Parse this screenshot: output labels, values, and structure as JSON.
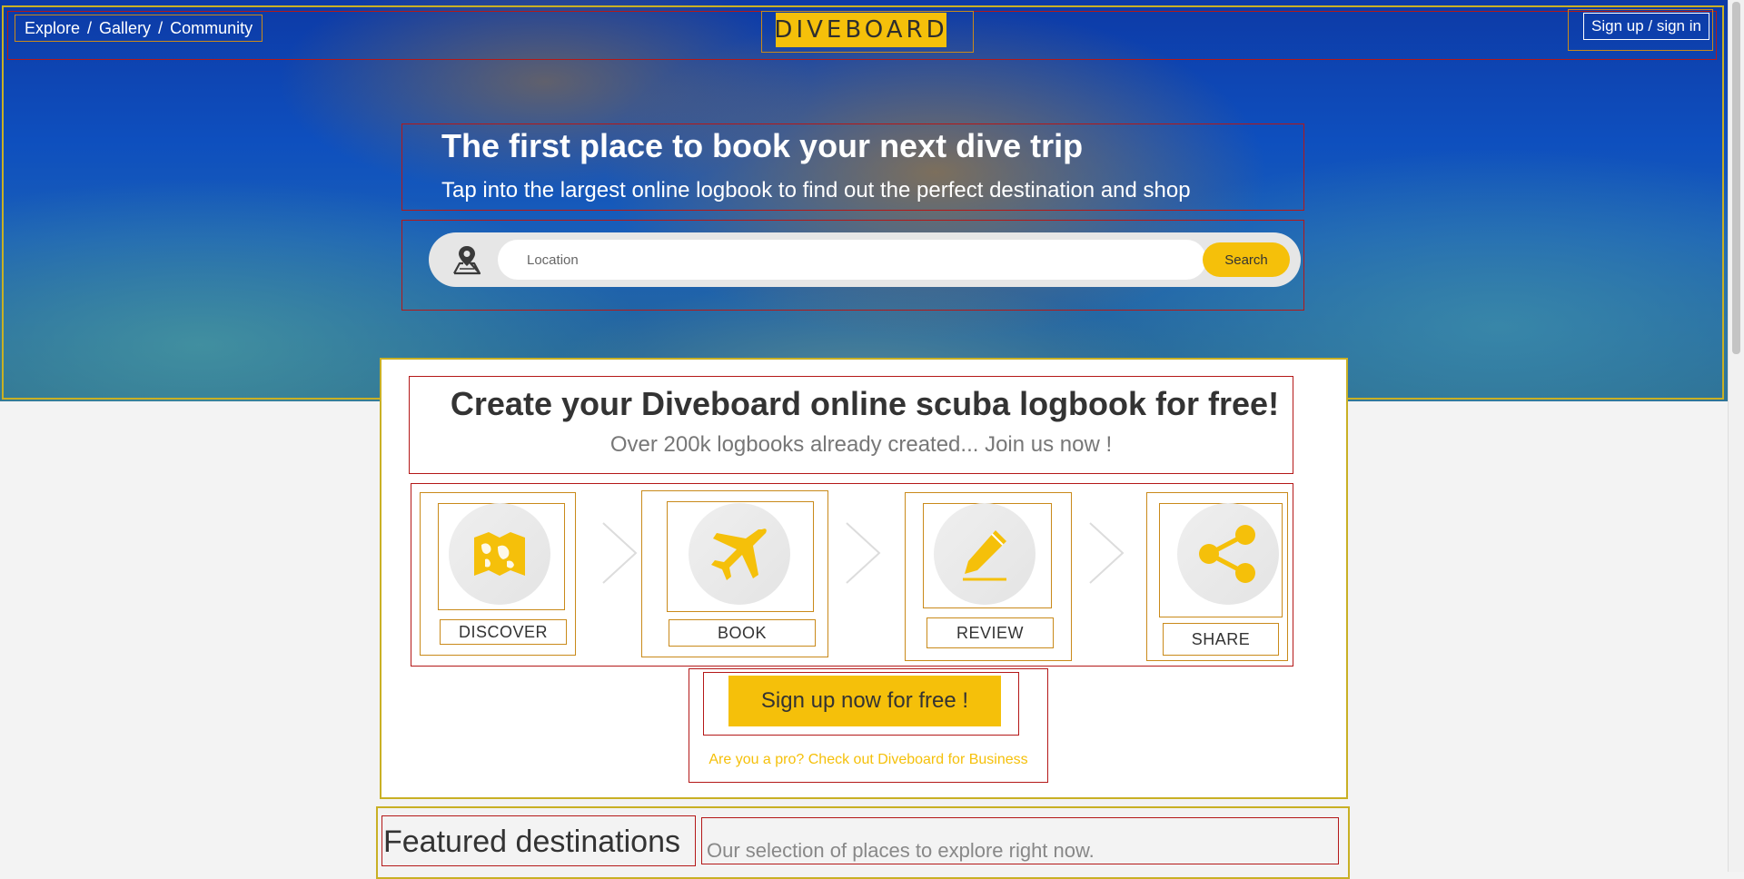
{
  "nav": {
    "links": [
      "Explore",
      "Gallery",
      "Community"
    ],
    "separator": "/"
  },
  "logo": {
    "text": "DIVEBOARD",
    "color": "#f5c00a"
  },
  "auth": {
    "signin_label": "Sign up / sign in"
  },
  "hero": {
    "title": "The first place to book your next dive trip",
    "subtitle": "Tap into the largest online logbook to find out the perfect destination and shop"
  },
  "search": {
    "placeholder": "Location",
    "button_label": "Search",
    "icon": "map-pin-icon"
  },
  "main": {
    "title": "Create your Diveboard online scuba logbook for free!",
    "subtitle": "Over 200k logbooks already created... Join us now !",
    "steps": [
      {
        "label": "DISCOVER",
        "icon": "map-icon"
      },
      {
        "label": "BOOK",
        "icon": "airplane-icon"
      },
      {
        "label": "REVIEW",
        "icon": "pencil-icon"
      },
      {
        "label": "SHARE",
        "icon": "share-icon"
      }
    ],
    "cta_label": "Sign up now for free !",
    "pro_link": "Are you a pro? Check out Diveboard for Business"
  },
  "featured": {
    "title": "Featured destinations",
    "subtitle": "Our selection of places to explore right now."
  },
  "colors": {
    "accent": "#f5c00a",
    "text": "#333333"
  }
}
